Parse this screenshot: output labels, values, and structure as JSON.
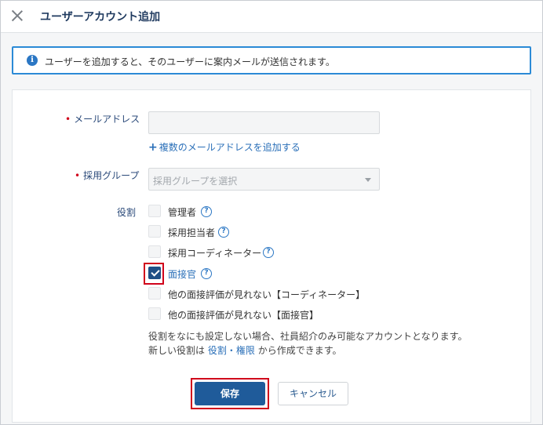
{
  "header": {
    "close_icon": "close-icon",
    "title": "ユーザーアカウント追加"
  },
  "info": {
    "icon": "info-icon",
    "text": "ユーザーを追加すると、そのユーザーに案内メールが送信されます。"
  },
  "form": {
    "required_mark": "•",
    "email": {
      "label": "メールアドレス",
      "value": "",
      "add_link_icon": "+",
      "add_link": "複数のメールアドレスを追加する"
    },
    "group": {
      "label": "採用グループ",
      "placeholder": "採用グループを選択"
    },
    "roles": {
      "label": "役割",
      "help_glyph": "?",
      "items": [
        {
          "label": "管理者",
          "checked": false
        },
        {
          "label": "採用担当者",
          "checked": false
        },
        {
          "label": "採用コーディネーター",
          "checked": false
        },
        {
          "label": "面接官",
          "checked": true
        },
        {
          "label": "他の面接評価が見れない【コーディネーター】",
          "checked": false
        },
        {
          "label": "他の面接評価が見れない【面接官】",
          "checked": false
        }
      ]
    },
    "note_line1": "役割をなにも設定しない場合、社員紹介のみ可能なアカウントとなります。",
    "note_line2_prefix": "新しい役割は",
    "note_line2_link": "役割・権限",
    "note_line2_suffix": "から作成できます。"
  },
  "buttons": {
    "save": "保存",
    "cancel": "キャンセル"
  }
}
